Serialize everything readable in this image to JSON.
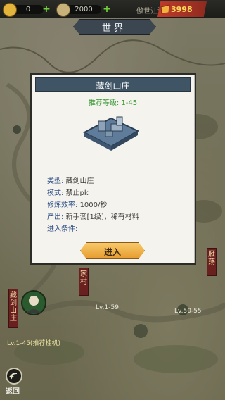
{
  "topbar": {
    "resource1": {
      "value": "0",
      "icon": "gold-coin-icon",
      "color": "#e3b33b"
    },
    "resource2": {
      "value": "2000",
      "icon": "silver-coin-icon",
      "color": "#c9b27a"
    },
    "world_tag": "傲世江湖",
    "ticket": {
      "value": "3998",
      "icon": "ticket-icon",
      "color": "#c23b2a"
    }
  },
  "banner": {
    "title": "世界"
  },
  "modal": {
    "title": "藏剑山庄",
    "recommended_level": "推荐等级: 1-45",
    "rows": [
      {
        "key": "类型:",
        "value": "藏剑山庄"
      },
      {
        "key": "模式:",
        "value": "禁止pk"
      },
      {
        "key": "修炼效率:",
        "value": "1000/秒"
      },
      {
        "key": "产出:",
        "value": "新手套[1级]，稀有材料"
      },
      {
        "key": "进入条件:",
        "value": ""
      }
    ],
    "enter_label": "进入"
  },
  "map": {
    "scroll_left": "藏剑山庄",
    "scroll_mid": "家村",
    "scroll_right": "雁荡",
    "location_lv_left": "Lv.1-59",
    "location_lv_right": "Lv.50-55",
    "player_location": "Lv.1-45(推荐挂机)"
  },
  "footer": {
    "back_label": "返回"
  }
}
